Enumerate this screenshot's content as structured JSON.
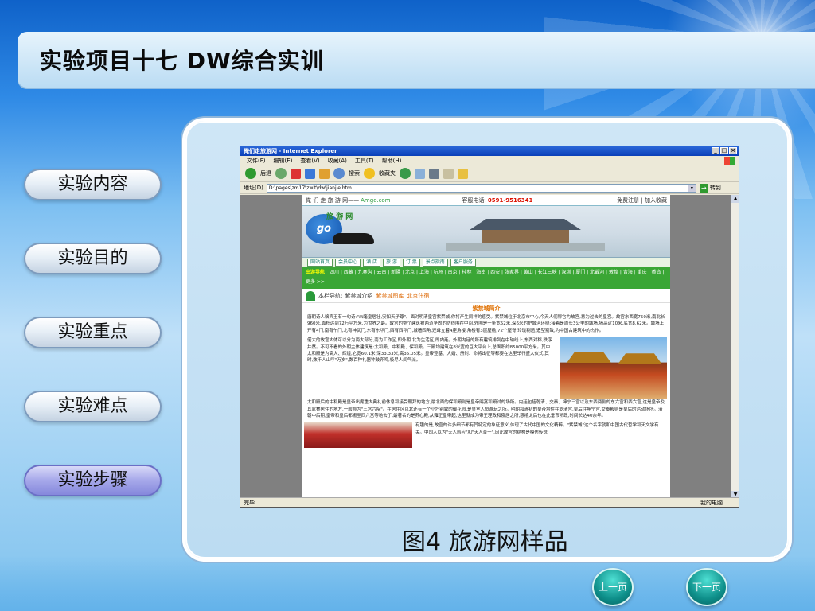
{
  "slide": {
    "title": "实验项目十七   DW综合实训",
    "caption": "图4 旅游网样品",
    "prev_label": "上一页",
    "next_label": "下一页",
    "colors": {
      "accent": "#0f62c9",
      "active_nav": "#8588dc",
      "nav_button": "#e6eef6",
      "round_button": "#0e8f8a"
    }
  },
  "nav": [
    {
      "label": "实验内容",
      "active": false
    },
    {
      "label": "实验目的",
      "active": false
    },
    {
      "label": "实验重点",
      "active": false
    },
    {
      "label": "实验难点",
      "active": false
    },
    {
      "label": "实验步骤",
      "active": true
    }
  ],
  "browser": {
    "window_title": "俺们走旅游网 - Internet Explorer",
    "menu": [
      "文件(F)",
      "编辑(E)",
      "查看(V)",
      "收藏(A)",
      "工具(T)",
      "帮助(H)"
    ],
    "toolbar": {
      "back": "后退",
      "search": "搜索",
      "favorites": "收藏夹"
    },
    "address_label": "地址(D)",
    "address_value": "D:\\pages\\zm17\\zwlt\\dw\\jianjie.htm",
    "go_label": "转到",
    "status_left": "完毕",
    "status_right": "我的电脑",
    "icons": [
      "back-icon",
      "forward-icon",
      "stop-icon",
      "refresh-icon",
      "home-icon",
      "search-icon",
      "favorites-icon",
      "history-icon",
      "mail-icon",
      "print-icon",
      "edit-icon",
      "messenger-icon"
    ]
  },
  "site": {
    "slogan": "俺 们 走 旅 游 网——",
    "domain": "Amgo.com",
    "phone_label": "客服电话:",
    "phone": "0591-9516341",
    "top_links": "免费注册  |  加入收藏",
    "logo_text": "旅 游 网",
    "logo_badge": "go",
    "nav": [
      "网站首页",
      "会员中心",
      "酒 店",
      "旅 游",
      "订 票",
      "景点指南",
      "客户服务"
    ],
    "city_label": "出游导航",
    "cities": "四川 | 西藏 | 九寨沟 | 云南 | 新疆 | 北京 | 上海 | 杭州 | 南京 | 桂林 | 海南 | 西安 | 张家界 | 黄山 | 长江三峡 | 深圳 | 厦门 | 北戴河 | 敦煌 | 青海 | 重庆 | 香岛 | 更多 >>",
    "crumb_label": "本栏导航:",
    "crumb_1": "紫禁城介绍",
    "crumb_2": "紫禁城图库",
    "crumb_3": "北京住宿",
    "section_title": "紫禁城简介",
    "para_1": "唐朝诗人骆宾王有一句诗:\"未睹皇居壮,安知天子尊\"。面对明清皇宫紫禁城,你将产生同样的感受。紫禁城位于北京市中心,今天人们称它为故宫,意为过去的皇宫。故宫东西宽750米,南北长960米,面积达到72万平方米,为世界之最。故宫的整个建筑被两道坚固的防线围在中间,外围是一条宽52米,深6米的护城河环绕;接着是周长3公里的城墙,墙高近10米,底宽8.62米。城墙上开有4门,南有午门,北有神武门,东有东华门,西有西华门,城墙四角,还耸立着4座角楼,角楼有3层屋檐,72个屋脊,玲珑剔透,造型别致,为中国古建筑中的杰作。",
    "para_2": "偌大的故宫大体可以分为两大部分,南为工作区,即外朝,北为生活区,即内廷。外朝内廷的所有建筑排列在中轴线上,东西对称,秩序井然。不可不看的外朝主体建筑是:太和殿、中和殿、保和殿。三殿均建筑在8米宽的巨大平台上,总面积约85000平方米。其中太和殿是为高大、辉煌,它宽60.1米,深33.33米,高35.05米。皇帝登基、大婚、册封、命将出征等都要在这里举行盛大仪式,其时,数千人山呼\"万岁\",数百种礼器钟鼓齐鸣,极尽人间气派。",
    "para_3": "太和殿后的中和殿是皇帝出席重大典礼前休息和接受朝拜的地方,最北面的保和殿则是皇帝赐宴和殿试的场所。内廷包括乾清、交泰、坤宁三宫以及东西两侧的东六宫和西六宫,这是皇帝及其家眷居住的地方,一般称为\"三宫六院\"。在居住区以北还有一个小巧别致的御花园,是皇室人员游玩之所。明朝和清初的皇帝均住在乾清宫,皇后住坤宁宫,交泰殿则是皇后的活动场所。清朝中后期,皇帝和皇后都搬至西六宫等地去了,最著名的是养心殿,从雍正皇帝起,这里就成为帝王理政和寝居之所,慈禧太后也在此垂帘听政,时间长达40余年。",
    "para_4": "有趣的是,故宫的许多细节都有其特定的象征意义,体现了古代中国的文化精粹。\"紫禁城\"这个名字就和中国古代哲学和天文学有关。中国人以为\"天人感应\"和\"天人合一\",因此故宫的结构是模仿传说"
  }
}
